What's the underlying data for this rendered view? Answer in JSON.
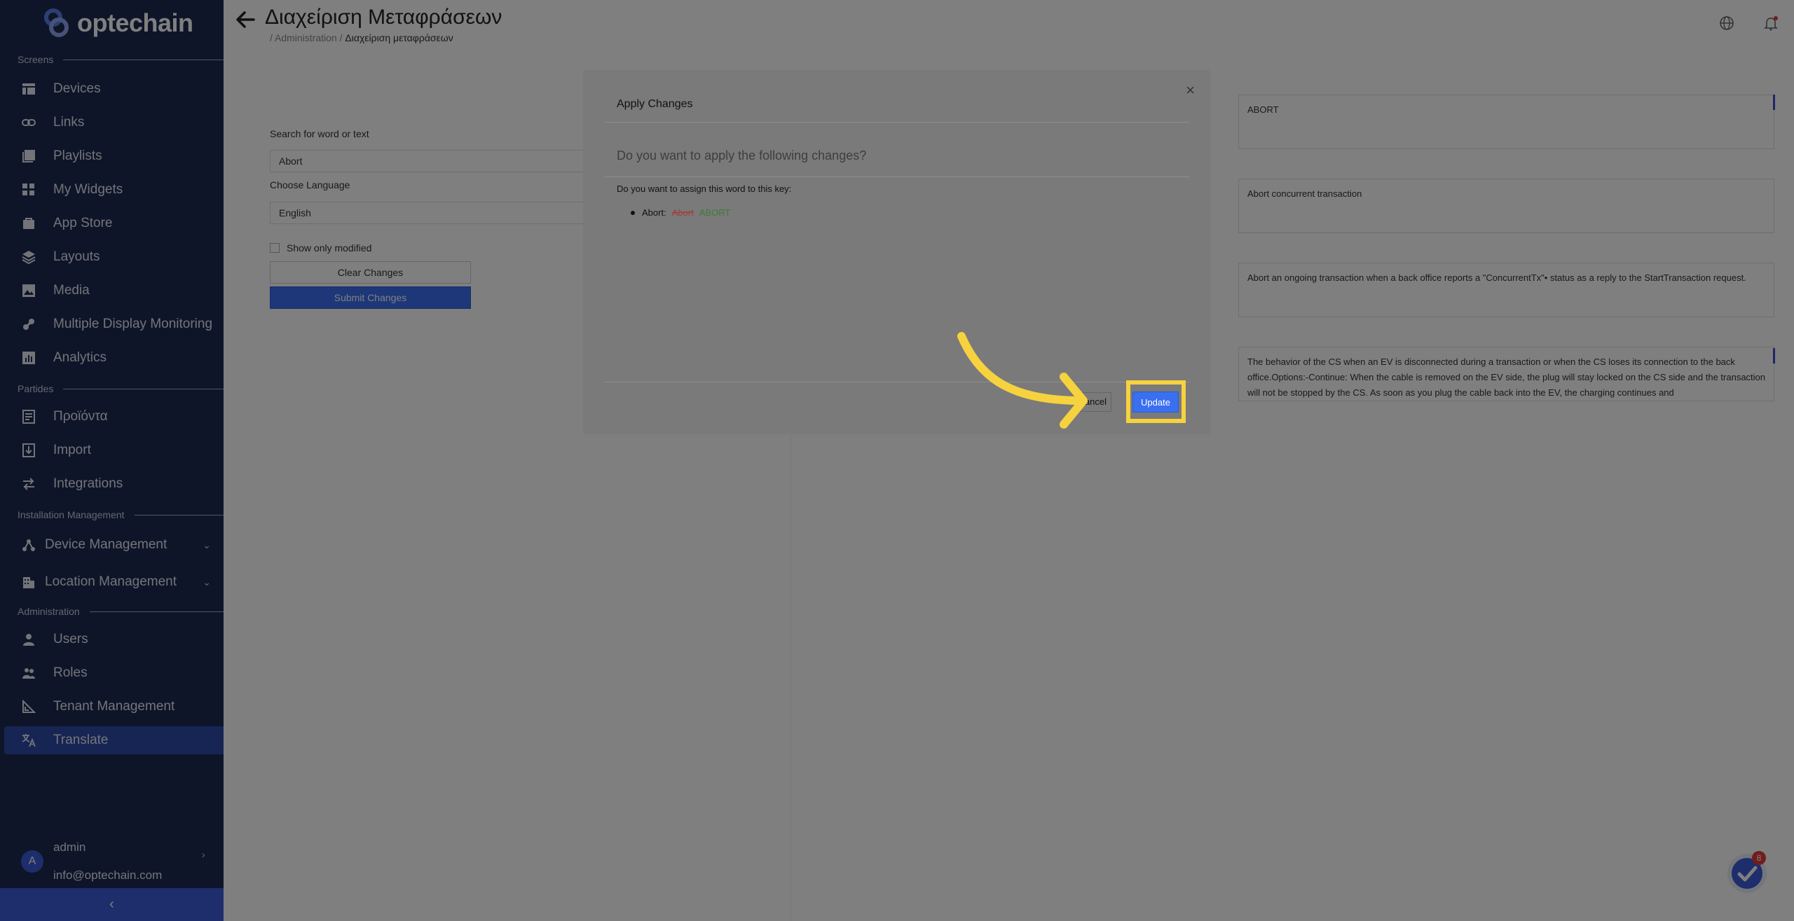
{
  "app": {
    "brand": "optechain",
    "page_title": "Διαχείριση Μεταφράσεων",
    "breadcrumb": {
      "parent": "Administration",
      "current": "Διαχείριση μεταφράσεων"
    }
  },
  "sidebar": {
    "sections": {
      "screens": "Screens",
      "partides": "Partides",
      "installation": "Installation Management",
      "administration": "Administration"
    },
    "items": {
      "devices": "Devices",
      "links": "Links",
      "playlists": "Playlists",
      "my_widgets": "My Widgets",
      "app_store": "App Store",
      "layouts": "Layouts",
      "media": "Media",
      "multiple_display": "Multiple Display Monitoring",
      "analytics": "Analytics",
      "products": "Προϊόντα",
      "import": "Import",
      "integrations": "Integrations",
      "device_management": "Device Management",
      "location_management": "Location Management",
      "users": "Users",
      "roles": "Roles",
      "tenant_management": "Tenant Management",
      "translate": "Translate"
    },
    "user": {
      "initial": "A",
      "name": "admin",
      "email": "info@optechain.com"
    }
  },
  "form": {
    "search_label": "Search for word or text",
    "search_value": "Abort",
    "language_label": "Choose Language",
    "language_value": "English",
    "show_modified_label": "Show only modified",
    "clear_label": "Clear Changes",
    "submit_label": "Submit Changes"
  },
  "translations": [
    "ABORT",
    "Abort concurrent transaction",
    "Abort an ongoing transaction when a back office reports a \"ConcurrentTx\"• status as a reply to the StartTransaction request.",
    "The behavior of the CS when an EV is disconnected during a transaction or when the CS loses its connection to the back office.Options:-Continue: When the cable is removed on the EV side, the plug will stay locked on the CS side and the transaction will not be stopped by the CS. As soon as you plug the cable back into the EV, the charging continues and"
  ],
  "help": {
    "badge": "8"
  },
  "modal": {
    "title": "Apply Changes",
    "close": "×",
    "question": "Do you want to apply the following changes?",
    "text": "Do you want to assign this word to this key:",
    "change_key": "Abort:",
    "change_old": "Abort",
    "change_new": "ABORT",
    "cancel_label": "Cancel",
    "update_label": "Update"
  },
  "colors": {
    "sidebar": "#1d2b53",
    "accent": "#3a6ff0",
    "highlight": "#f6d23f"
  }
}
